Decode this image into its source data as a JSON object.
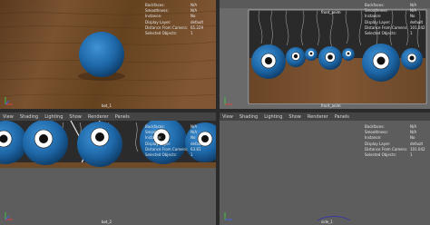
{
  "viewports": {
    "top_left": {
      "hud": [
        {
          "label": "Backfaces:",
          "value": "N/A"
        },
        {
          "label": "Smoothness:",
          "value": "N/A"
        },
        {
          "label": "Instance:",
          "value": "No"
        },
        {
          "label": "Display Layer:",
          "value": "default"
        },
        {
          "label": "Distance From Camera:",
          "value": "65.229"
        },
        {
          "label": "Selected Objects:",
          "value": "1"
        }
      ],
      "cam_label": "bot_1"
    },
    "top_right": {
      "header_text": "front_anim",
      "hud": [
        {
          "label": "Backfaces:",
          "value": "N/A"
        },
        {
          "label": "Smoothness:",
          "value": "N/A"
        },
        {
          "label": "Instance:",
          "value": "No"
        },
        {
          "label": "Display Layer:",
          "value": "default"
        },
        {
          "label": "Distance From Camera:",
          "value": "101.042"
        },
        {
          "label": "Selected Objects:",
          "value": "1"
        }
      ],
      "cam_label": "front_anim"
    },
    "bottom_left": {
      "menu": [
        "View",
        "Shading",
        "Lighting",
        "Show",
        "Renderer",
        "Panels"
      ],
      "hud": [
        {
          "label": "Backfaces:",
          "value": "N/A"
        },
        {
          "label": "Smoothness:",
          "value": "N/A"
        },
        {
          "label": "Instance:",
          "value": "No"
        },
        {
          "label": "Display Layer:",
          "value": "default"
        },
        {
          "label": "Distance From Camera:",
          "value": "63.81"
        },
        {
          "label": "Selected Objects:",
          "value": "1"
        }
      ],
      "cam_label": "bot_2"
    },
    "bottom_right": {
      "menu": [
        "View",
        "Shading",
        "Lighting",
        "Show",
        "Renderer",
        "Panels"
      ],
      "hud": [
        {
          "label": "Backfaces:",
          "value": "N/A"
        },
        {
          "label": "Smoothness:",
          "value": "N/A"
        },
        {
          "label": "Instance:",
          "value": "No"
        },
        {
          "label": "Display Layer:",
          "value": "default"
        },
        {
          "label": "Distance From Camera:",
          "value": "101.042"
        },
        {
          "label": "Selected Objects:",
          "value": "1"
        }
      ],
      "cam_label": "side_1"
    }
  },
  "colors": {
    "wood": "#6e4a28",
    "ball": "#1f6aa8",
    "ball_dark": "#0f3f6a",
    "backdrop": "#2a2a2a",
    "empty_view": "#5d5d5d",
    "selection": "#ffffff"
  }
}
